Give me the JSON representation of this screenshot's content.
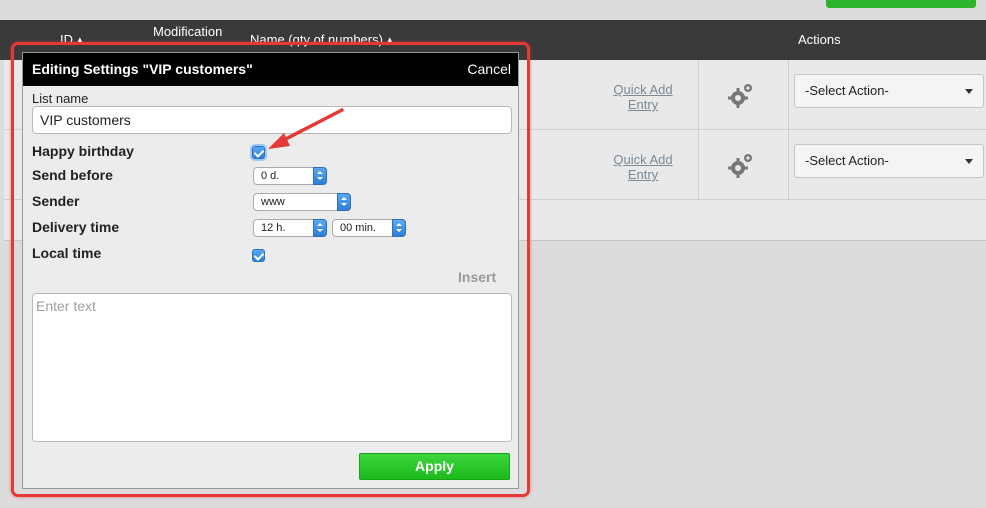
{
  "table": {
    "header": {
      "id": "ID ▴",
      "modification": "Modification",
      "name": "Name (qty of numbers) ▴",
      "actions": "Actions"
    },
    "rows": [
      {
        "quick_add": "Quick Add Entry",
        "action_select": "-Select Action-"
      },
      {
        "quick_add": "Quick Add Entry",
        "action_select": "-Select Action-"
      }
    ]
  },
  "modal": {
    "title": "Editing Settings \"VIP customers\"",
    "cancel": "Cancel",
    "list_name_label": "List name",
    "list_name_value": "VIP customers",
    "happy_birthday_label": "Happy birthday",
    "happy_birthday_checked": true,
    "send_before_label": "Send before",
    "send_before_value": "0 d.",
    "sender_label": "Sender",
    "sender_value": "www",
    "delivery_time_label": "Delivery time",
    "delivery_hours_value": "12 h.",
    "delivery_minutes_value": "00 min.",
    "local_time_label": "Local time",
    "local_time_checked": true,
    "insert_label": "Insert",
    "text_placeholder": "Enter text",
    "apply_label": "Apply"
  },
  "colors": {
    "header_bg": "#3a3a3a",
    "modal_header_bg": "#000000",
    "apply_green": "#22c022",
    "highlight_red": "#e53935",
    "checkbox_blue": "#3d8fe3"
  },
  "icons": [
    "gear-icon",
    "arrow-annotation-icon",
    "chevron-down-icon",
    "checkmark-icon"
  ]
}
